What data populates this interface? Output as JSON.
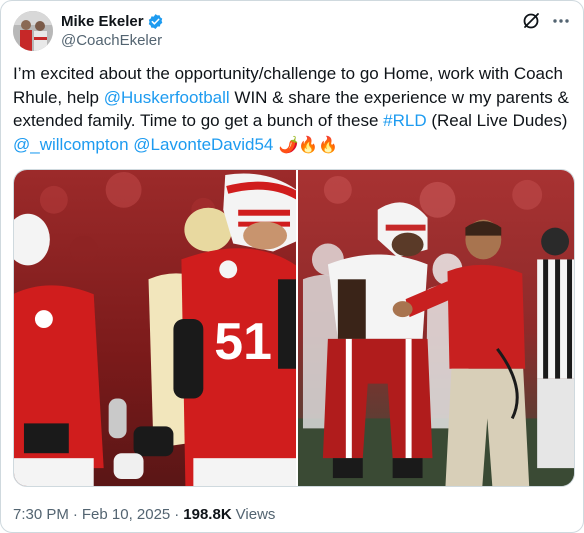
{
  "author": {
    "display_name": "Mike Ekeler",
    "handle": "@CoachEkeler",
    "verified": true,
    "avatar_icon": "profile-avatar"
  },
  "actions": {
    "grok_icon": "grok-icon",
    "more_icon": "more-icon"
  },
  "tweet": {
    "seg1": "I’m excited about the opportunity/challenge to go Home, work with Coach Rhule, help ",
    "mention_husker": "@Huskerfootball",
    "seg2": "  WIN & share the experience w my parents & extended family.  Time to go get a bunch of these ",
    "hashtag": "#RLD",
    "seg3": " (Real Live Dudes) ",
    "mention_will": "@_willcompton",
    "seg4": " ",
    "mention_lavonte": "@LavonteDavid54",
    "emojis": " 🌶️🔥🔥"
  },
  "media": {
    "left_jersey_number": "51",
    "left_photo_icon": "football-player-photo",
    "right_photo_icon": "coach-sideline-photo"
  },
  "meta": {
    "time": "7:30 PM",
    "date": "Feb 10, 2025",
    "separator": "·",
    "views_count": "198.8K",
    "views_label": "Views"
  },
  "colors": {
    "link": "#1d9bf0",
    "secondary_text": "#536471",
    "husker_red": "#d00000"
  }
}
